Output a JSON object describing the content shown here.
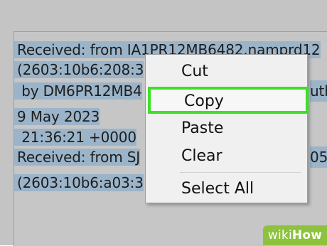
{
  "text_lines": [
    "Received: from IA1PR12MB6482.namprd12",
    "(2603:10b6:208:3",
    " by DM6PR12MB4",
    "9 May 2023",
    " 21:36:21 +0000",
    "Received: from SJ",
    "(2603:10b6:a03:3"
  ],
  "right_fragments": {
    "line3": "uth",
    "line6": "05"
  },
  "context_menu": {
    "items": [
      "Cut",
      "Copy",
      "Paste",
      "Clear",
      "Select All"
    ],
    "highlighted": "Copy"
  },
  "watermark": {
    "wiki": "wiki",
    "how": "How"
  },
  "colors": {
    "selection": "#9bb4c9",
    "highlight_border": "#3ce026",
    "menu_background": "#f0f0f0",
    "watermark": "#8dc23f"
  }
}
